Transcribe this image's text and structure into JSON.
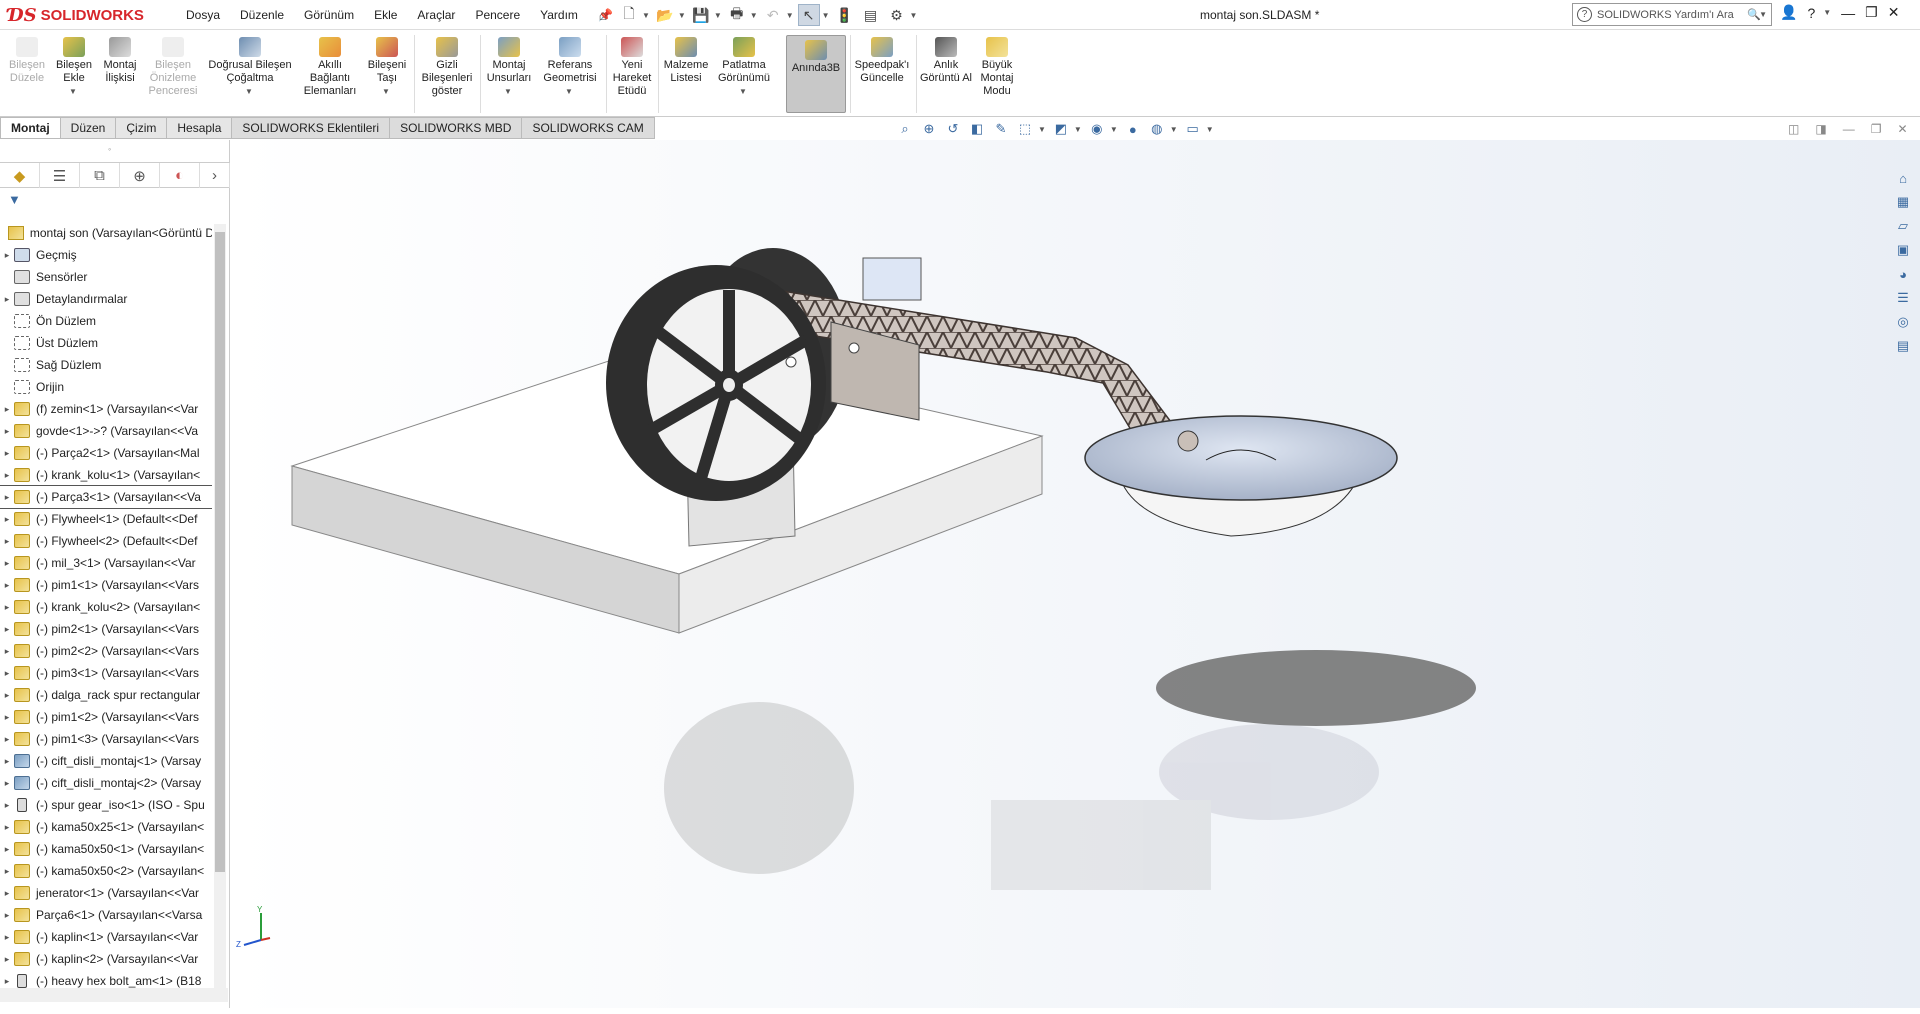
{
  "app": {
    "brand": "SOLIDWORKS",
    "doc_title": "montaj son.SLDASM *"
  },
  "menu": [
    "Dosya",
    "Düzenle",
    "Görünüm",
    "Ekle",
    "Araçlar",
    "Pencere",
    "Yardım"
  ],
  "search": {
    "placeholder": "SOLIDWORKS Yardım'ı Ara"
  },
  "ribbon": {
    "b1": "Bileşen Düzele",
    "b2": "Bileşen Ekle",
    "b3": "Montaj İlişkisi",
    "b4": "Bileşen Önizleme Penceresi",
    "b5": "Doğrusal Bileşen Çoğaltma",
    "b6": "Akıllı Bağlantı Elemanları",
    "b7": "Bileşeni Taşı",
    "b8": "Gizli Bileşenleri göster",
    "b9": "Montaj Unsurları",
    "b10": "Referans Geometrisi",
    "b11": "Yeni Hareket Etüdü",
    "b12": "Malzeme Listesi",
    "b13": "Patlatma Görünümü",
    "b14": "Anında3B",
    "b15": "Speedpak'ı Güncelle",
    "b16": "Anlık Görüntü Al",
    "b17": "Büyük Montaj Modu"
  },
  "tabs": [
    "Montaj",
    "Düzen",
    "Çizim",
    "Hesapla",
    "SOLIDWORKS Eklentileri",
    "SOLIDWORKS MBD",
    "SOLIDWORKS CAM"
  ],
  "tree": {
    "root": "montaj son  (Varsayılan<Görüntü D",
    "items": [
      {
        "label": "Geçmiş",
        "icon": "hist"
      },
      {
        "label": "Sensörler",
        "icon": "sens"
      },
      {
        "label": "Detaylandırmalar",
        "icon": "sens"
      },
      {
        "label": "Ön Düzlem",
        "icon": "plane"
      },
      {
        "label": "Üst Düzlem",
        "icon": "plane"
      },
      {
        "label": "Sağ Düzlem",
        "icon": "plane"
      },
      {
        "label": "Orijin",
        "icon": "origin"
      },
      {
        "label": "(f) zemin<1> (Varsayılan<<Var",
        "icon": "asm"
      },
      {
        "label": "govde<1>->? (Varsayılan<<Va",
        "icon": "asm"
      },
      {
        "label": "(-) Parça2<1> (Varsayılan<Mal",
        "icon": "asm"
      },
      {
        "label": "(-) krank_kolu<1> (Varsayılan<",
        "icon": "asm"
      },
      {
        "label": "(-) Parça3<1> (Varsayılan<<Va",
        "icon": "asm"
      },
      {
        "label": "(-) Flywheel<1> (Default<<Def",
        "icon": "asm"
      },
      {
        "label": "(-) Flywheel<2> (Default<<Def",
        "icon": "asm"
      },
      {
        "label": "(-) mil_3<1> (Varsayılan<<Var",
        "icon": "asm"
      },
      {
        "label": "(-) pim1<1> (Varsayılan<<Vars",
        "icon": "asm"
      },
      {
        "label": "(-) krank_kolu<2> (Varsayılan<",
        "icon": "asm"
      },
      {
        "label": "(-) pim2<1> (Varsayılan<<Vars",
        "icon": "asm"
      },
      {
        "label": "(-) pim2<2> (Varsayılan<<Vars",
        "icon": "asm"
      },
      {
        "label": "(-) pim3<1> (Varsayılan<<Vars",
        "icon": "asm"
      },
      {
        "label": "(-) dalga_rack spur rectangular",
        "icon": "asm"
      },
      {
        "label": "(-) pim1<2> (Varsayılan<<Vars",
        "icon": "asm"
      },
      {
        "label": "(-) pim1<3> (Varsayılan<<Vars",
        "icon": "asm"
      },
      {
        "label": "(-) cift_disli_montaj<1> (Varsay",
        "icon": "gear"
      },
      {
        "label": "(-) cift_disli_montaj<2> (Varsay",
        "icon": "gear"
      },
      {
        "label": "(-) spur gear_iso<1> (ISO - Spu",
        "icon": "bolt"
      },
      {
        "label": "(-) kama50x25<1> (Varsayılan<",
        "icon": "asm"
      },
      {
        "label": "(-) kama50x50<1> (Varsayılan<",
        "icon": "asm"
      },
      {
        "label": "(-) kama50x50<2> (Varsayılan<",
        "icon": "asm"
      },
      {
        "label": "jenerator<1> (Varsayılan<<Var",
        "icon": "asm"
      },
      {
        "label": "Parça6<1> (Varsayılan<<Varsa",
        "icon": "asm"
      },
      {
        "label": "(-) kaplin<1> (Varsayılan<<Var",
        "icon": "asm"
      },
      {
        "label": "(-) kaplin<2> (Varsayılan<<Var",
        "icon": "asm"
      },
      {
        "label": "(-) heavy hex bolt_am<1> (B18",
        "icon": "bolt"
      }
    ],
    "selected_index": 11
  },
  "colors": {
    "accent": "#d7262b",
    "ui_blue": "#3b6aa0"
  }
}
